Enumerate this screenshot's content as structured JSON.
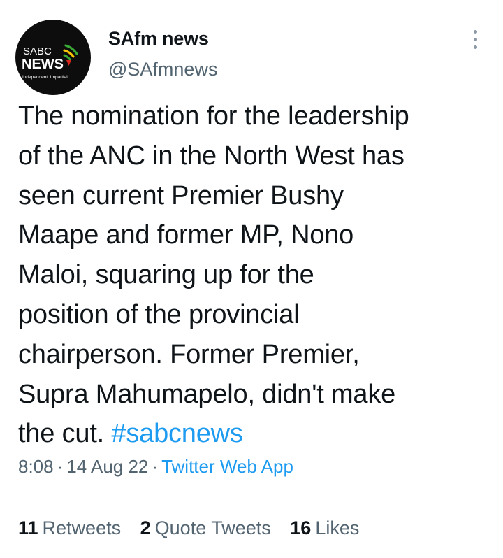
{
  "author": {
    "display_name": "SAfm news",
    "handle": "@SAfmnews",
    "avatar": {
      "logo_top": "SABC",
      "logo_main": "NEWS",
      "tagline": "Independent. Impartial.",
      "colors": {
        "background": "#0d0d0d",
        "wave_green": "#3aa935",
        "wave_yellow": "#f6c400",
        "wave_red": "#d9261c"
      }
    }
  },
  "more_icon": "more-vertical-icon",
  "tweet": {
    "lines": [
      "The nomination for the leadership",
      "of the ANC in the North West has",
      "seen current Premier Bushy",
      "Maape and former MP, Nono",
      "Maloi, squaring up for the",
      "position of the provincial",
      "chairperson. Former Premier,",
      "Supra Mahumapelo, didn't make",
      "the cut."
    ],
    "hashtag": "#sabcnews"
  },
  "meta": {
    "time": "8:08",
    "date": "14 Aug 22",
    "separator": "·",
    "source": "Twitter Web App"
  },
  "stats": [
    {
      "count": "11",
      "label": "Retweets"
    },
    {
      "count": "2",
      "label": "Quote Tweets"
    },
    {
      "count": "16",
      "label": "Likes"
    }
  ],
  "colors": {
    "text": "#0f1419",
    "secondary": "#536471",
    "link": "#1d9bf0",
    "divider": "#e1e6ea"
  }
}
